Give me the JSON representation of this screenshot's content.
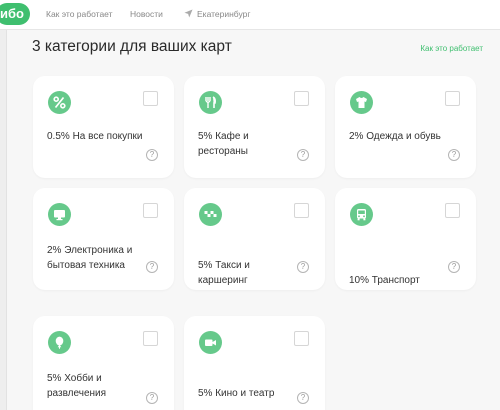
{
  "nav": {
    "logo": "ибо",
    "links": [
      "Как это работает",
      "Новости"
    ],
    "city": "Екатеринбург",
    "city_icon": "location-arrow-icon"
  },
  "panel": {
    "title": "3 категории для ваших карт",
    "how_link": "Как это работает"
  },
  "categories": [
    {
      "label": "0.5% На все покупки",
      "icon": "percent-icon"
    },
    {
      "label": "5% Кафе и рестораны",
      "icon": "fork-knife-icon"
    },
    {
      "label": "2% Одежда и обувь",
      "icon": "tshirt-icon"
    },
    {
      "label": "2% Электроника и бытовая техника",
      "icon": "monitor-icon"
    },
    {
      "label": "5% Такси и каршеринг",
      "icon": "taxi-checker-icon"
    },
    {
      "label": "10% Транспорт",
      "icon": "bus-icon"
    },
    {
      "label": "5% Хобби и развлечения",
      "icon": "balloon-icon"
    },
    {
      "label": "5% Кино и театр",
      "icon": "camera-icon"
    }
  ],
  "help_symbol": "?",
  "colors": {
    "accent": "#3fbf6f",
    "icon_bg": "#66c98b"
  }
}
